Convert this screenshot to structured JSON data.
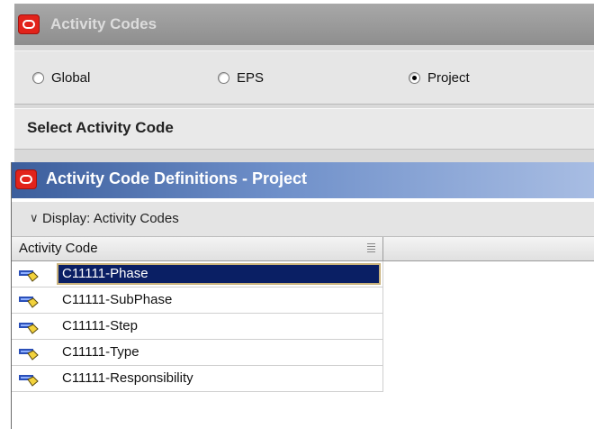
{
  "back_window": {
    "title": "Activity Codes",
    "scope_options": [
      {
        "label": "Global",
        "selected": false
      },
      {
        "label": "EPS",
        "selected": false
      },
      {
        "label": "Project",
        "selected": true
      }
    ],
    "select_header": "Select Activity Code"
  },
  "front_window": {
    "title": "Activity Code Definitions - Project",
    "display_label": "Display: Activity Codes",
    "column_header": "Activity Code",
    "rows": [
      {
        "label": "C11111-Phase",
        "selected": true
      },
      {
        "label": "C11111-SubPhase",
        "selected": false
      },
      {
        "label": "C11111-Step",
        "selected": false
      },
      {
        "label": "C11111-Type",
        "selected": false
      },
      {
        "label": "C11111-Responsibility",
        "selected": false
      }
    ]
  },
  "icons": {
    "logo": "oracle-logo-icon",
    "row": "activity-code-icon",
    "collapse": "chevron-down-icon",
    "column_menu": "column-menu-icon"
  },
  "colors": {
    "selection_bg": "#0a1f64",
    "title_gradient_start": "#3c5e9c",
    "logo_red": "#e2231a"
  }
}
